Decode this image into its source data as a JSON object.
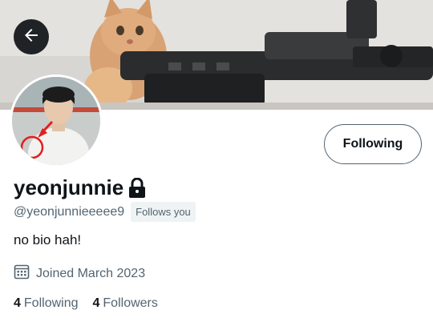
{
  "profile": {
    "display_name": "yeonjunnie",
    "handle": "@yeonjunnieeeee9",
    "follows_you": "Follows you",
    "bio": "no bio hah!",
    "joined": "Joined March 2023",
    "following_count": "4",
    "following_label": "Following",
    "followers_count": "4",
    "followers_label": "Followers"
  },
  "actions": {
    "follow_button_label": "Following"
  },
  "icons": {
    "back": "arrow-left-icon",
    "lock": "lock-icon",
    "calendar": "calendar-icon"
  },
  "colors": {
    "primary_text": "#0f1419",
    "secondary_text": "#536471",
    "badge_bg": "#eff3f4",
    "back_button_bg": "#1f2326"
  }
}
